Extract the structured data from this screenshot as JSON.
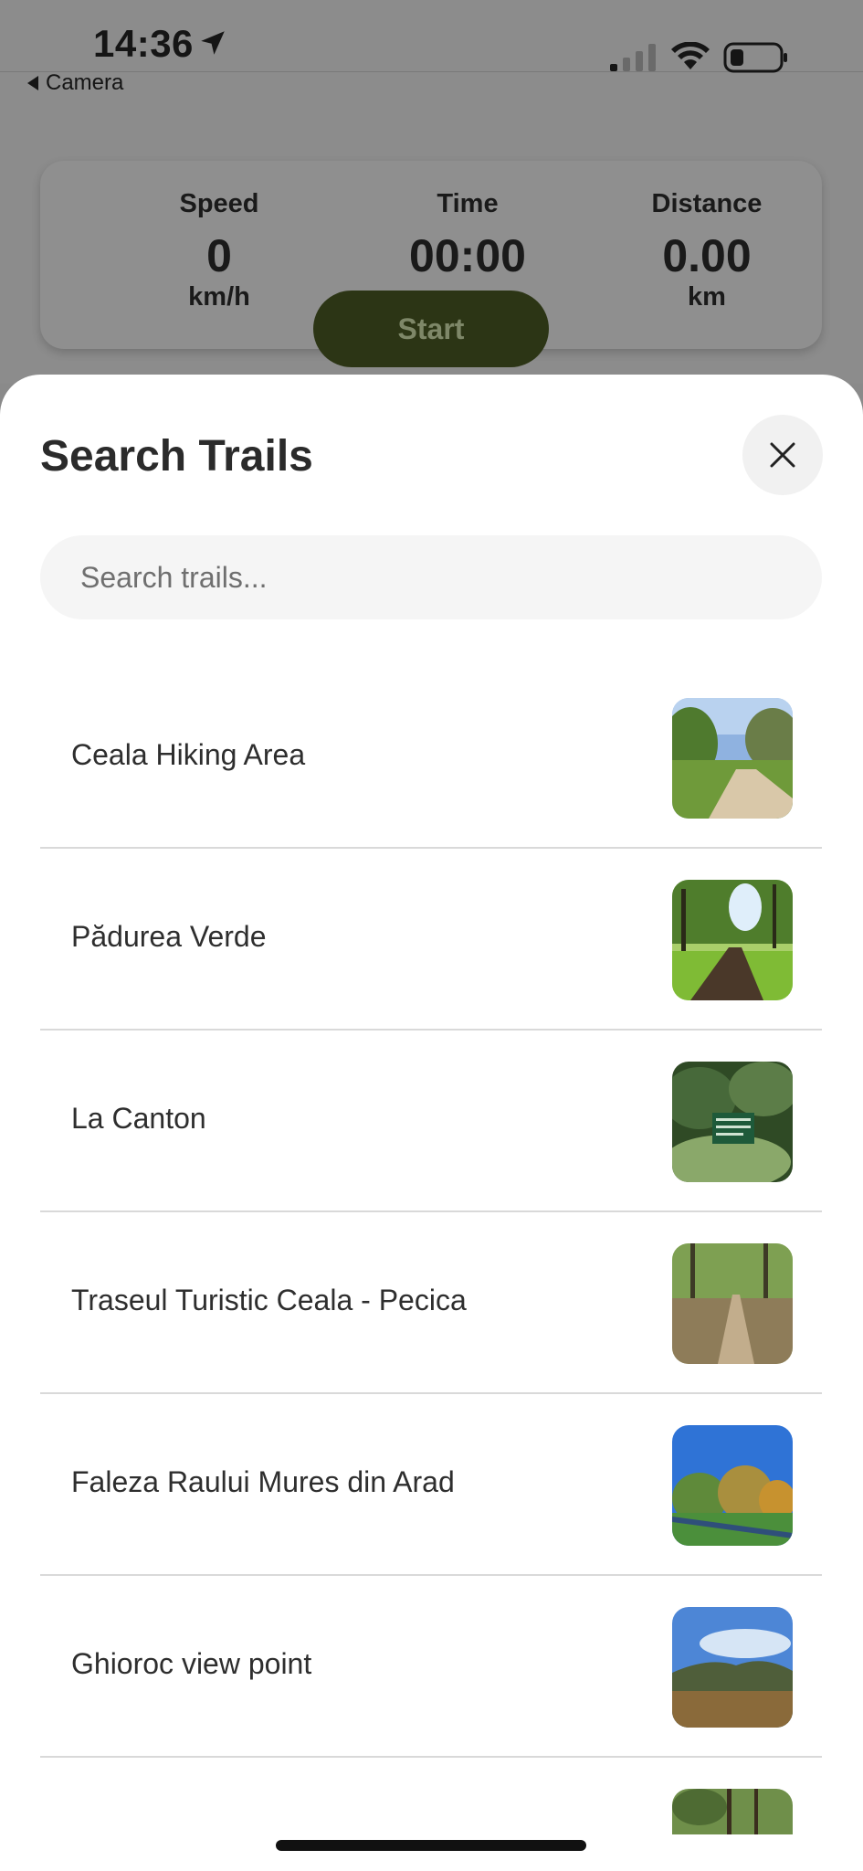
{
  "status_bar": {
    "time": "14:36",
    "back_label": "Camera"
  },
  "stats": {
    "speed_label": "Speed",
    "speed_value": "0",
    "speed_unit": "km/h",
    "time_label": "Time",
    "time_value": "00:00",
    "distance_label": "Distance",
    "distance_value": "0.00",
    "distance_unit": "km",
    "start_label": "Start"
  },
  "sheet": {
    "title": "Search Trails",
    "search_placeholder": "Search trails..."
  },
  "trails": [
    {
      "name": "Ceala Hiking Area",
      "image": "dirt-road-photo"
    },
    {
      "name": "Pădurea Verde",
      "image": "forest-path-photo"
    },
    {
      "name": "La Canton",
      "image": "forest-sign-photo"
    },
    {
      "name": "Traseul Turistic Ceala - Pecica",
      "image": "woodland-trail-photo"
    },
    {
      "name": "Faleza Raului Mures din Arad",
      "image": "riverbank-photo"
    },
    {
      "name": "Ghioroc view point",
      "image": "hills-view-photo"
    },
    {
      "name": "",
      "image": "trees-photo"
    }
  ],
  "colors": {
    "start_button": "#2c3515",
    "sheet_bg": "#ffffff",
    "input_bg": "#f5f5f5"
  }
}
